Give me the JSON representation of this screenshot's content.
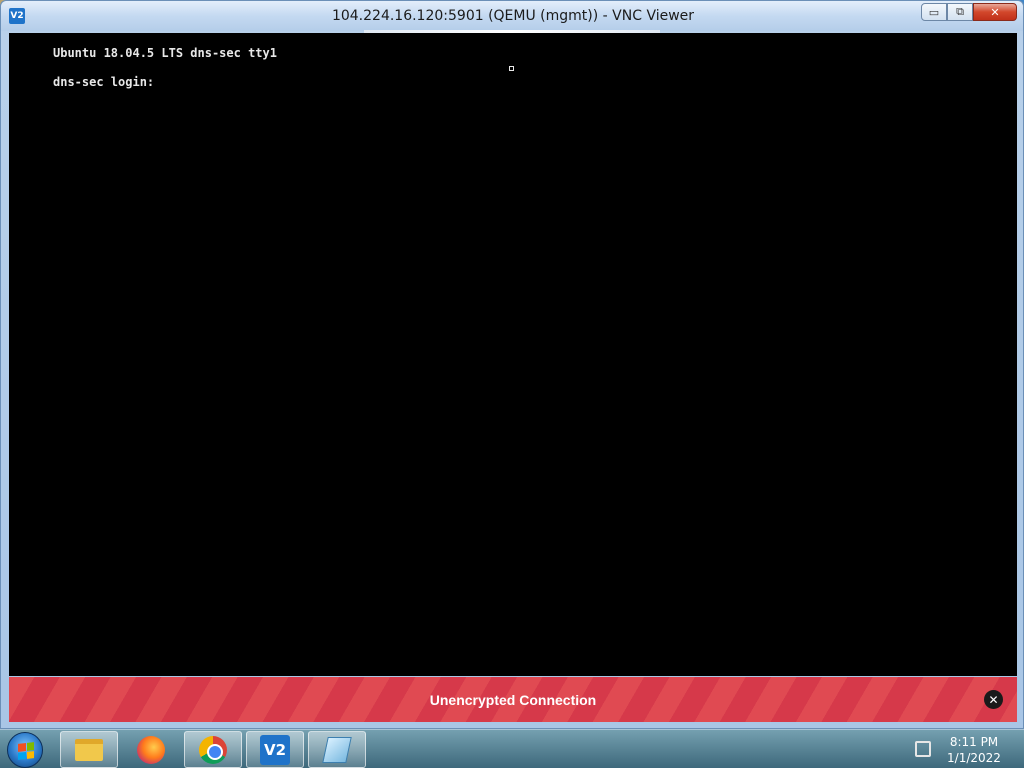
{
  "window": {
    "title": "104.224.16.120:5901 (QEMU (mgmt)) - VNC Viewer",
    "app_icon": "V2",
    "controls": {
      "minimize": "▭",
      "maximize": "⧉",
      "close": "✕"
    }
  },
  "terminal": {
    "lines": [
      "Ubuntu 18.04.5 LTS dns-sec tty1",
      "dns-sec login: "
    ]
  },
  "banner": {
    "text": "Unencrypted Connection",
    "close": "✕",
    "color": "#e04a52"
  },
  "taskbar": {
    "apps": [
      {
        "name": "windows-explorer",
        "icon": "folder-icon"
      },
      {
        "name": "firefox",
        "icon": "firefox-icon"
      },
      {
        "name": "chrome",
        "icon": "chrome-icon"
      },
      {
        "name": "vnc-viewer",
        "icon": "vnc-icon",
        "glyph": "V2"
      },
      {
        "name": "notepad",
        "icon": "notepad-icon"
      }
    ],
    "clock": {
      "time": "8:11 PM",
      "date": "1/1/2022"
    }
  }
}
